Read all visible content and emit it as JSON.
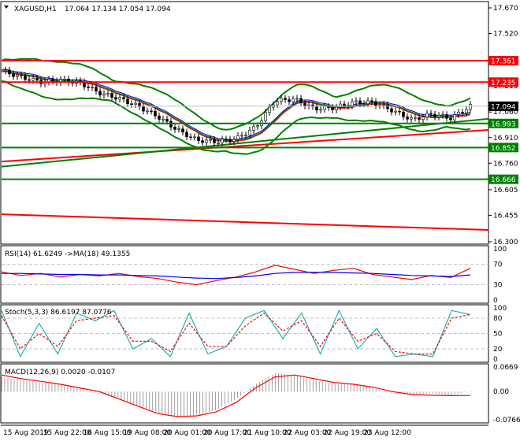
{
  "header": {
    "symbol": "XAGUSD,H1",
    "ohlc": "17.064 17.134 17.054 17.094"
  },
  "colors": {
    "bull": "#000000",
    "up_level": "#ff0000",
    "dn_level": "#008000",
    "rsi": "#ff0000",
    "rsi_ma": "#0000ff",
    "stoch_main": "#20b2aa",
    "stoch_signal": "#ff0000",
    "macd_hist": "#a0a0a0",
    "macd_signal": "#ff0000"
  },
  "chart_data": [
    {
      "type": "line",
      "title": "XAGUSD,H1",
      "ylim": [
        16.3,
        17.67
      ],
      "yticks": [
        "17.670",
        "17.520",
        "17.213",
        "17.060",
        "16.910",
        "16.760",
        "16.605",
        "16.455",
        "16.300"
      ],
      "ytick_values": [
        17.67,
        17.52,
        17.213,
        17.06,
        16.91,
        16.76,
        16.605,
        16.455,
        16.3
      ],
      "xticks": [
        "15 Aug 2019",
        "15 Aug 22:00",
        "16 Aug 15:00",
        "19 Aug 08:00",
        "20 Aug 01:00",
        "20 Aug 17:00",
        "21 Aug 10:00",
        "22 Aug 03:00",
        "22 Aug 19:00",
        "23 Aug 12:00"
      ],
      "close": [
        17.301,
        17.264,
        17.236,
        17.246,
        17.232,
        17.172,
        17.14,
        17.093,
        17.033,
        16.955,
        16.895,
        16.886,
        16.904,
        16.969,
        17.126,
        17.135,
        17.08,
        17.084,
        17.116,
        17.116,
        17.07,
        17.015,
        17.047,
        17.024,
        17.094
      ],
      "current_price": "17.094",
      "resistance_levels": [
        "17.361",
        "17.235"
      ],
      "support_levels": [
        "16.993",
        "16.852",
        "16.666"
      ],
      "trendlines": [
        {
          "color": "red",
          "from": 16.461,
          "to": 16.369
        },
        {
          "color": "red",
          "from": 16.77,
          "to": 16.955
        },
        {
          "color": "green",
          "from": 16.74,
          "to": 17.02
        }
      ]
    },
    {
      "type": "line",
      "title": "RSI(14) 61.6249  ->MA(18) 49.1355",
      "ylim": [
        0,
        100
      ],
      "yticks": [
        "100",
        "70",
        "30",
        "0"
      ],
      "ytick_values": [
        100,
        70,
        30,
        0
      ],
      "rsi": [
        55,
        48,
        52,
        45,
        50,
        47,
        52,
        46,
        42,
        35,
        30,
        38,
        45,
        55,
        68,
        60,
        52,
        58,
        62,
        50,
        45,
        40,
        48,
        44,
        62
      ],
      "ma": [
        52,
        52,
        51,
        50,
        50,
        49,
        49,
        48,
        47,
        45,
        43,
        42,
        44,
        47,
        52,
        54,
        54,
        54,
        53,
        52,
        50,
        48,
        47,
        46,
        49
      ]
    },
    {
      "type": "line",
      "title": "Stoch(5,3,3) 86.6197 87.0776",
      "ylim": [
        0,
        100
      ],
      "yticks": [
        "100",
        "80",
        "50",
        "20",
        "0"
      ],
      "ytick_values": [
        100,
        80,
        50,
        20,
        0
      ],
      "main": [
        95,
        5,
        70,
        10,
        90,
        75,
        95,
        20,
        40,
        5,
        90,
        10,
        25,
        80,
        95,
        40,
        90,
        10,
        95,
        20,
        60,
        5,
        10,
        5,
        95,
        87
      ],
      "signal": [
        85,
        20,
        50,
        25,
        75,
        80,
        85,
        35,
        35,
        15,
        70,
        25,
        25,
        65,
        90,
        55,
        75,
        25,
        80,
        35,
        50,
        15,
        10,
        10,
        80,
        87
      ]
    },
    {
      "type": "bar",
      "title": "MACD(12,26,9) 0.0020 -0.0107",
      "ylim": [
        -0.0766,
        0.0669
      ],
      "yticks": [
        "0.0669",
        "0.00",
        "-0.0766"
      ],
      "ytick_values": [
        0.0669,
        0,
        -0.0766
      ],
      "hist": [
        0.04,
        0.03,
        0.025,
        0.02,
        0.01,
        -0.005,
        -0.02,
        -0.04,
        -0.06,
        -0.07,
        -0.065,
        -0.05,
        -0.02,
        0.02,
        0.05,
        0.045,
        0.03,
        0.02,
        0.02,
        0.01,
        -0.005,
        -0.01,
        -0.005,
        -0.01,
        0.002
      ],
      "signal": [
        0.045,
        0.035,
        0.028,
        0.02,
        0.01,
        0.0,
        -0.02,
        -0.04,
        -0.06,
        -0.068,
        -0.066,
        -0.055,
        -0.03,
        0.01,
        0.04,
        0.045,
        0.035,
        0.025,
        0.02,
        0.012,
        0.0,
        -0.008,
        -0.01,
        -0.011,
        -0.0107
      ]
    }
  ]
}
